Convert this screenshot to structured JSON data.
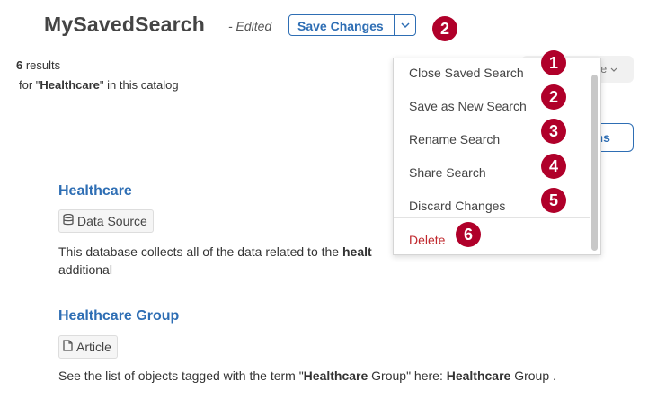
{
  "header": {
    "title": "MySavedSearch",
    "edited_label": "- Edited",
    "save_label": "Save Changes",
    "callout_number": "2"
  },
  "results": {
    "count": "6",
    "count_suffix": " results",
    "for_prefix": "for \"",
    "query": "Healthcare",
    "for_suffix": "\" in this catalog"
  },
  "background_controls": {
    "sort_label": "e",
    "options_label": "ons"
  },
  "items": [
    {
      "title": "Healthcare",
      "tag": "Data Source",
      "tag_icon": "database-icon",
      "desc_1": "This database collects all of the data related to the ",
      "desc_bold": "healt",
      "desc_2": "additional"
    },
    {
      "title": "Healthcare Group",
      "tag": "Article",
      "tag_icon": "document-icon",
      "desc_1": "See the list of objects tagged with the term \"",
      "desc_b1": "Healthcare",
      "desc_2": " Group\" here: ",
      "desc_b2": "Healthcare",
      "desc_3": " Group ."
    }
  ],
  "menu": {
    "items": [
      {
        "label": "Close Saved Search",
        "callout": "1"
      },
      {
        "label": "Save as New Search",
        "callout": "2"
      },
      {
        "label": "Rename Search",
        "callout": "3"
      },
      {
        "label": "Share Search",
        "callout": "4"
      },
      {
        "label": "Discard Changes",
        "callout": "5"
      },
      {
        "label": "Delete",
        "callout": "6"
      }
    ]
  },
  "colors": {
    "accent": "#2e6eb4",
    "callout": "#b0002a",
    "danger": "#c0282d"
  }
}
